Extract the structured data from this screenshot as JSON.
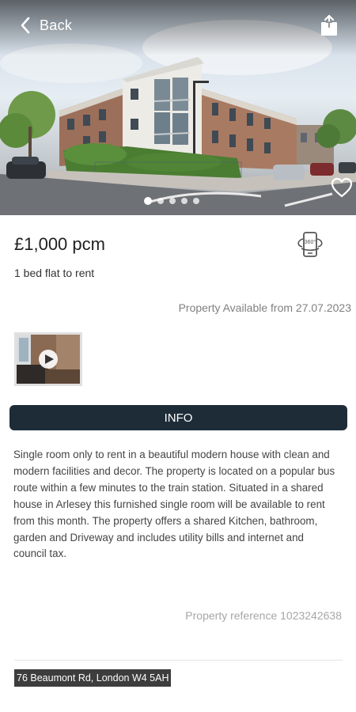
{
  "header": {
    "back_label": "Back",
    "back_icon": "chevron-left-icon",
    "share_icon": "share-icon",
    "favorite_icon": "heart-icon"
  },
  "gallery": {
    "image_count": 5,
    "active_index": 0
  },
  "listing": {
    "price": "£1,000 pcm",
    "summary": "1 bed flat to rent",
    "tour_icon": "360-view-icon",
    "availability": "Property Available from 27.07.2023",
    "video_icon": "play-icon"
  },
  "info_tab": {
    "label": "INFO"
  },
  "description": "Single room only to rent in a beautiful modern house with clean and modern facilities and decor. The property is located on a popular bus route within a few minutes to the train station. Situated in a shared house in Arlesey this furnished single room will be available to rent from this month. The property offers a shared Kitchen, bathroom, garden and Driveway and includes utility bills and internet and council tax.",
  "reference": "Property reference 1023242638",
  "address": "76 Beaumont Rd, London W4 5AH",
  "colors": {
    "info_bar": "#1e2c38",
    "muted_text": "#808080",
    "address_bg": "#3d3d3d"
  }
}
